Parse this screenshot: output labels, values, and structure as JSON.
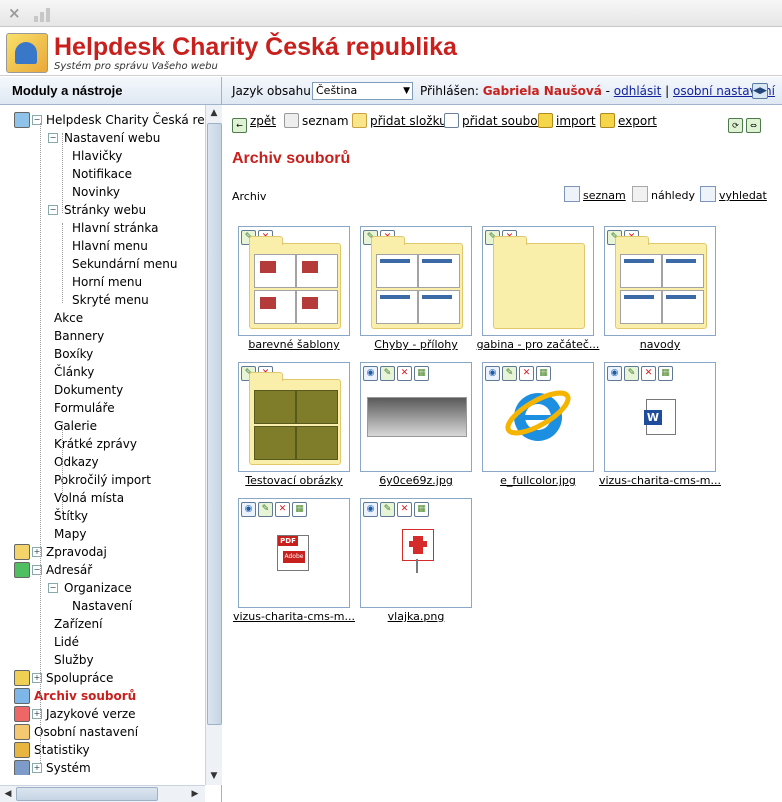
{
  "window": {
    "close_glyph": "×",
    "signal_icon": "signal-bars-icon"
  },
  "header": {
    "title": "Helpdesk Charity Česká republika",
    "subtitle": "Systém pro správu Vašeho webu"
  },
  "sidebar": {
    "heading": "Moduly a nástroje",
    "tree": [
      {
        "label": "Helpdesk Charity Česká repub",
        "icon": "site-icon",
        "box": "−"
      },
      {
        "label": "Nastavení webu",
        "box": "−"
      },
      {
        "label": "Hlavičky"
      },
      {
        "label": "Notifikace"
      },
      {
        "label": "Novinky"
      },
      {
        "label": "Stránky webu",
        "box": "−"
      },
      {
        "label": "Hlavní stránka"
      },
      {
        "label": "Hlavní menu"
      },
      {
        "label": "Sekundární menu"
      },
      {
        "label": "Horní menu"
      },
      {
        "label": "Skryté menu"
      },
      {
        "label": "Akce"
      },
      {
        "label": "Bannery"
      },
      {
        "label": "Boxíky"
      },
      {
        "label": "Články"
      },
      {
        "label": "Dokumenty"
      },
      {
        "label": "Formuláře"
      },
      {
        "label": "Galerie"
      },
      {
        "label": "Krátké zprávy"
      },
      {
        "label": "Odkazy"
      },
      {
        "label": "Pokročilý import"
      },
      {
        "label": "Volná místa"
      },
      {
        "label": "Štítky"
      },
      {
        "label": "Mapy"
      },
      {
        "label": "Zpravodaj",
        "icon": "envelope-icon",
        "box": "+"
      },
      {
        "label": "Adresář",
        "icon": "database-icon",
        "box": "−"
      },
      {
        "label": "Organizace",
        "box": "−"
      },
      {
        "label": "Nastavení"
      },
      {
        "label": "Zařízení"
      },
      {
        "label": "Lidé"
      },
      {
        "label": "Služby"
      },
      {
        "label": "Spolupráce",
        "icon": "collaboration-icon",
        "box": "+"
      },
      {
        "label": "Archiv souborů",
        "icon": "archive-icon",
        "active": true
      },
      {
        "label": "Jazykové verze",
        "icon": "flag-icon",
        "box": "+"
      },
      {
        "label": "Osobní nastavení",
        "icon": "user-icon"
      },
      {
        "label": "Statistiky",
        "icon": "chart-icon"
      },
      {
        "label": "Systém",
        "icon": "hammer-icon",
        "box": "+"
      }
    ]
  },
  "contentbar": {
    "language_label": "Jazyk obsahu:",
    "language_value": "Čeština",
    "logged_label": "Přihlášen:",
    "user_name": "Gabriela Naušová",
    "separator1": " - ",
    "logout": "odhlásit",
    "separator2": " | ",
    "personal_settings": "osobní nastavení"
  },
  "toolbar": {
    "back": "zpět",
    "list": "seznam",
    "add_folder": "přidat složku",
    "add_file": "přidat soubor",
    "import": "import",
    "export": "export"
  },
  "page": {
    "title": "Archiv souborů",
    "breadcrumb": "Archiv",
    "view_list": "seznam",
    "view_previews": "náhledy",
    "search": "vyhledat"
  },
  "files": [
    {
      "label": "barevné šablony",
      "kind": "folder"
    },
    {
      "label": "Chyby - přílohy",
      "kind": "folder"
    },
    {
      "label": "gabina - pro začáteč...",
      "kind": "folder"
    },
    {
      "label": "navody",
      "kind": "folder"
    },
    {
      "label": "Testovací obrázky",
      "kind": "folder"
    },
    {
      "label": "6y0ce69z.jpg",
      "kind": "image"
    },
    {
      "label": "e_fullcolor.jpg",
      "kind": "image"
    },
    {
      "label": "vizus-charita-cms-m...",
      "kind": "word"
    },
    {
      "label": "vizus-charita-cms-m...",
      "kind": "pdf"
    },
    {
      "label": "vlajka.png",
      "kind": "image"
    }
  ]
}
